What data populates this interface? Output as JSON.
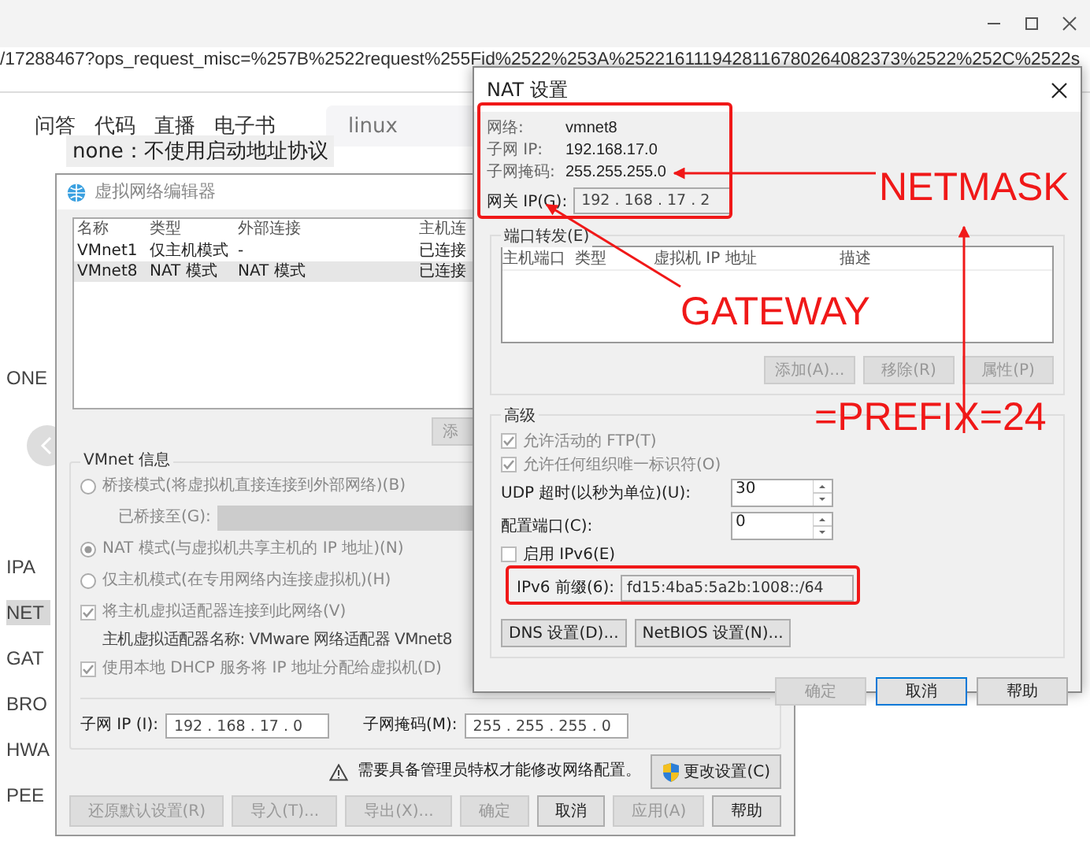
{
  "browser": {
    "url": "/17288467?ops_request_misc=%257B%2522request%255Fid%2522%253A%2522161119428116780264082373%2522%252C%2522s",
    "nav": [
      "问答",
      "代码",
      "直播",
      "电子书"
    ],
    "search": {
      "placeholder": "linux"
    },
    "highlight": "none：不使用启动地址协议",
    "side_labels": [
      {
        "text": "ONE",
        "highlighted": false
      },
      {
        "text": "IPA",
        "highlighted": false
      },
      {
        "text": "NET",
        "highlighted": true
      },
      {
        "text": "GAT",
        "highlighted": false
      },
      {
        "text": "BRO",
        "highlighted": false
      },
      {
        "text": "HWA",
        "highlighted": false
      },
      {
        "text": "PEE",
        "highlighted": false
      }
    ]
  },
  "network_editor": {
    "title": "虚拟网络编辑器",
    "columns": [
      "名称",
      "类型",
      "外部连接",
      "主机连"
    ],
    "rows": [
      {
        "cells": [
          "VMnet1",
          "仅主机模式",
          "-",
          "已连接"
        ],
        "selected": false
      },
      {
        "cells": [
          "VMnet8",
          "NAT 模式",
          "NAT 模式",
          "已连接"
        ],
        "selected": true
      }
    ],
    "add_button": "添",
    "vmnet_info": {
      "label": "VMnet 信息",
      "items": [
        {
          "kind": "radio",
          "label": "桥接模式(将虚拟机直接连接到外部网络)(B)",
          "selected": false
        },
        {
          "kind": "dropdown",
          "label": "已桥接至(G):"
        },
        {
          "kind": "radio",
          "label": "NAT 模式(与虚拟机共享主机的 IP 地址)(N)",
          "selected": true
        },
        {
          "kind": "radio",
          "label": "仅主机模式(在专用网络内连接虚拟机)(H)",
          "selected": false
        },
        {
          "kind": "checkbox",
          "label": "将主机虚拟适配器连接到此网络(V)",
          "checked": true
        },
        {
          "kind": "note",
          "label": "主机虚拟适配器名称: VMware 网络适配器 VMnet8"
        },
        {
          "kind": "checkbox",
          "label": "使用本地 DHCP 服务将 IP 地址分配给虚拟机(D)",
          "checked": true
        }
      ],
      "subnet_ip": {
        "label": "子网 IP (I):",
        "value": "192 . 168 . 17 . 0"
      },
      "subnet_mask": {
        "label": "子网掩码(M):",
        "value": "255 . 255 . 255 . 0"
      }
    },
    "admin_note": "需要具备管理员特权才能修改网络配置。",
    "change_button": "更改设置(C)",
    "buttons": [
      {
        "label": "还原默认设置(R)",
        "disabled": true
      },
      {
        "label": "导入(T)...",
        "disabled": true
      },
      {
        "label": "导出(X)...",
        "disabled": true
      },
      {
        "label": "确定",
        "disabled": true
      },
      {
        "label": "取消",
        "disabled": false
      },
      {
        "label": "应用(A)",
        "disabled": true
      },
      {
        "label": "帮助",
        "disabled": false
      }
    ]
  },
  "nat_settings": {
    "title": "NAT 设置",
    "info": [
      {
        "label": "网络:",
        "value": "vmnet8"
      },
      {
        "label": "子网 IP:",
        "value": "192.168.17.0"
      },
      {
        "label": "子网掩码:",
        "value": "255.255.255.0"
      }
    ],
    "gateway": {
      "label": "网关 IP(G):",
      "value": "192 . 168 . 17 . 2"
    },
    "port_forwarding": {
      "label": "端口转发(E)",
      "columns": [
        "主机端口",
        "类型",
        "虚拟机 IP 地址",
        "描述"
      ],
      "buttons": [
        {
          "label": "添加(A)...",
          "disabled": true
        },
        {
          "label": "移除(R)",
          "disabled": true
        },
        {
          "label": "属性(P)",
          "disabled": true
        }
      ]
    },
    "advanced": {
      "label": "高级",
      "items": [
        {
          "kind": "checkbox",
          "label": "允许活动的 FTP(T)",
          "checked": true
        },
        {
          "kind": "checkbox",
          "label": "允许任何组织唯一标识符(O)",
          "checked": true
        },
        {
          "kind": "spin",
          "label": "UDP 超时(以秒为单位)(U):",
          "value": "30"
        },
        {
          "kind": "spin",
          "label": "配置端口(C):",
          "value": "0"
        },
        {
          "kind": "checkbox",
          "label": "启用 IPv6(E)",
          "checked": false
        },
        {
          "kind": "field",
          "label": "IPv6 前缀(6):",
          "value": "fd15:4ba5:5a2b:1008::/64"
        }
      ],
      "buttons": [
        "DNS 设置(D)...",
        "NetBIOS 设置(N)..."
      ]
    },
    "buttons": [
      {
        "label": "确定",
        "disabled": true,
        "focused": false
      },
      {
        "label": "取消",
        "disabled": false,
        "focused": true
      },
      {
        "label": "帮助",
        "disabled": false,
        "focused": false
      }
    ]
  },
  "annotations": [
    {
      "text": "NETMASK"
    },
    {
      "text": "GATEWAY"
    },
    {
      "text": "=PREFIX=24"
    }
  ]
}
